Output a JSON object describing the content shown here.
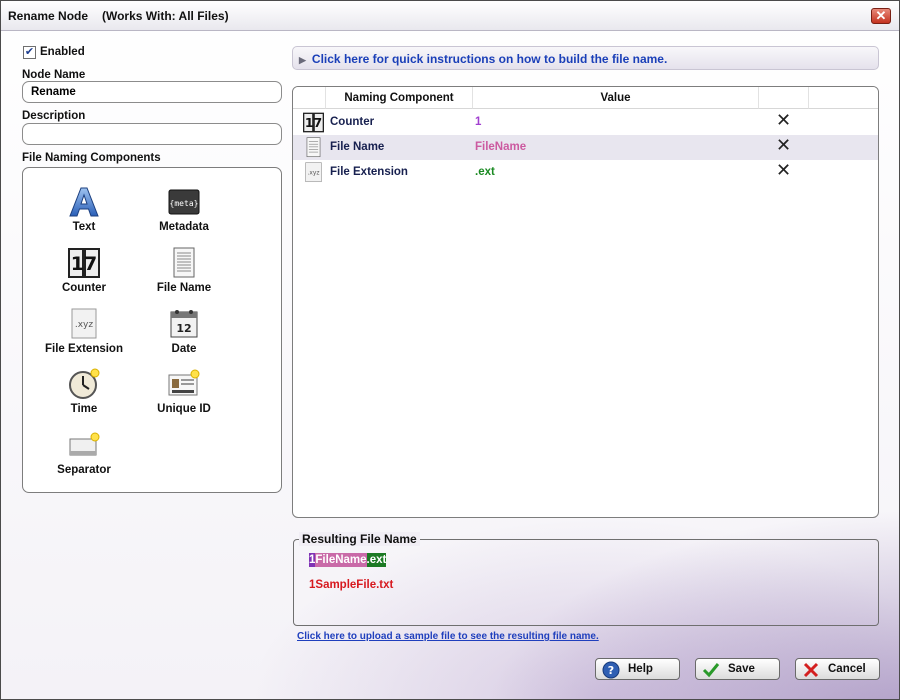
{
  "window": {
    "title": "Rename Node",
    "subtitle": "(Works With: All Files)",
    "close_label": "✕"
  },
  "left": {
    "enabled_checked": true,
    "enabled_label": "Enabled",
    "node_name_label": "Node Name",
    "node_name_value": "Rename",
    "description_label": "Description",
    "description_value": "",
    "components_label": "File Naming Components",
    "components": [
      {
        "label": "Text",
        "icon": "text-icon"
      },
      {
        "label": "Metadata",
        "icon": "metadata-icon",
        "icon_text": "{meta}"
      },
      {
        "label": "Counter",
        "icon": "counter-icon",
        "icon_text": "17"
      },
      {
        "label": "File Name",
        "icon": "file-name-icon"
      },
      {
        "label": "File Extension",
        "icon": "file-extension-icon",
        "icon_text": ".xyz"
      },
      {
        "label": "Date",
        "icon": "date-icon",
        "icon_text": "12"
      },
      {
        "label": "Time",
        "icon": "time-icon"
      },
      {
        "label": "Unique ID",
        "icon": "unique-id-icon"
      },
      {
        "label": "Separator",
        "icon": "separator-icon"
      }
    ]
  },
  "instructions": {
    "text": "Click here for quick instructions on how to build the file name."
  },
  "grid": {
    "headers": [
      "Naming Component",
      "Value"
    ],
    "rows": [
      {
        "name": "Counter",
        "value": "1",
        "value_color": "#a13fd0",
        "icon": "counter-icon",
        "icon_text": "17"
      },
      {
        "name": "File Name",
        "value": "FileName",
        "value_color": "#cc5aa0",
        "icon": "file-name-icon"
      },
      {
        "name": "File Extension",
        "value": ".ext",
        "value_color": "#1a8a22",
        "icon": "file-extension-icon",
        "icon_text": ".xyz"
      }
    ],
    "delete_glyph": "✕"
  },
  "result": {
    "title": "Resulting File Name",
    "preview": [
      "1",
      "FileName",
      ".ext"
    ],
    "sample": "1SampleFile.txt"
  },
  "upload_link": "Click here to upload a sample file to see the resulting file name.",
  "buttons": {
    "help": "Help",
    "save": "Save",
    "cancel": "Cancel"
  },
  "colors": {
    "link": "#1f3fbd",
    "sample_red": "#d7191f"
  }
}
